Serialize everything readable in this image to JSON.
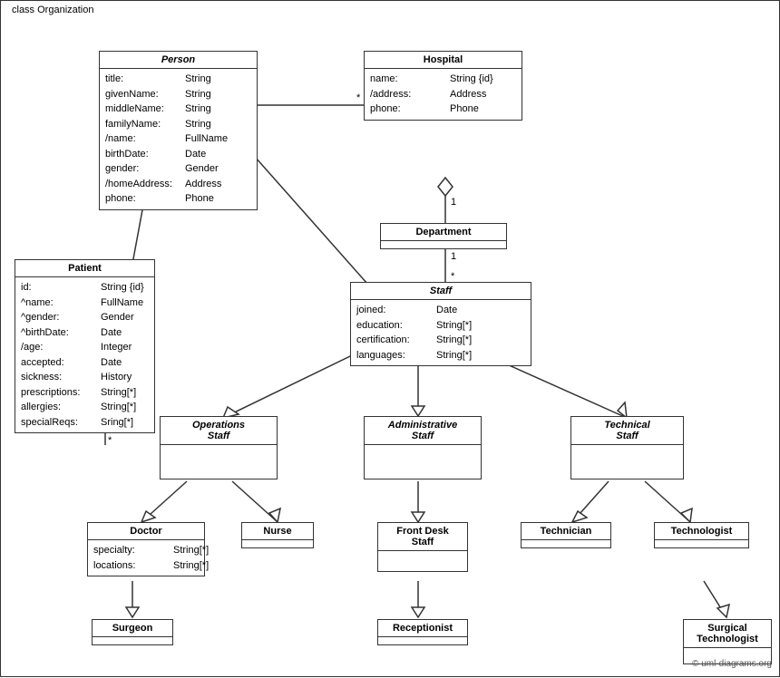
{
  "diagram": {
    "title": "class Organization",
    "classes": {
      "person": {
        "name": "Person",
        "italic": true,
        "attrs": [
          {
            "name": "title:",
            "type": "String"
          },
          {
            "name": "givenName:",
            "type": "String"
          },
          {
            "name": "middleName:",
            "type": "String"
          },
          {
            "name": "familyName:",
            "type": "String"
          },
          {
            "name": "/name:",
            "type": "FullName"
          },
          {
            "name": "birthDate:",
            "type": "Date"
          },
          {
            "name": "gender:",
            "type": "Gender"
          },
          {
            "name": "/homeAddress:",
            "type": "Address"
          },
          {
            "name": "phone:",
            "type": "Phone"
          }
        ]
      },
      "hospital": {
        "name": "Hospital",
        "italic": false,
        "attrs": [
          {
            "name": "name:",
            "type": "String {id}"
          },
          {
            "name": "/address:",
            "type": "Address"
          },
          {
            "name": "phone:",
            "type": "Phone"
          }
        ]
      },
      "department": {
        "name": "Department",
        "italic": false,
        "attrs": []
      },
      "staff": {
        "name": "Staff",
        "italic": true,
        "attrs": [
          {
            "name": "joined:",
            "type": "Date"
          },
          {
            "name": "education:",
            "type": "String[*]"
          },
          {
            "name": "certification:",
            "type": "String[*]"
          },
          {
            "name": "languages:",
            "type": "String[*]"
          }
        ]
      },
      "patient": {
        "name": "Patient",
        "italic": false,
        "attrs": [
          {
            "name": "id:",
            "type": "String {id}"
          },
          {
            "name": "^name:",
            "type": "FullName"
          },
          {
            "name": "^gender:",
            "type": "Gender"
          },
          {
            "name": "^birthDate:",
            "type": "Date"
          },
          {
            "name": "/age:",
            "type": "Integer"
          },
          {
            "name": "accepted:",
            "type": "Date"
          },
          {
            "name": "sickness:",
            "type": "History"
          },
          {
            "name": "prescriptions:",
            "type": "String[*]"
          },
          {
            "name": "allergies:",
            "type": "String[*]"
          },
          {
            "name": "specialReqs:",
            "type": "Sring[*]"
          }
        ]
      },
      "operations_staff": {
        "name": "Operations\nStaff",
        "italic": true,
        "attrs": []
      },
      "administrative_staff": {
        "name": "Administrative\nStaff",
        "italic": true,
        "attrs": []
      },
      "technical_staff": {
        "name": "Technical\nStaff",
        "italic": true,
        "attrs": []
      },
      "doctor": {
        "name": "Doctor",
        "italic": false,
        "attrs": [
          {
            "name": "specialty:",
            "type": "String[*]"
          },
          {
            "name": "locations:",
            "type": "String[*]"
          }
        ]
      },
      "nurse": {
        "name": "Nurse",
        "italic": false,
        "attrs": []
      },
      "front_desk_staff": {
        "name": "Front Desk\nStaff",
        "italic": false,
        "attrs": []
      },
      "technician": {
        "name": "Technician",
        "italic": false,
        "attrs": []
      },
      "technologist": {
        "name": "Technologist",
        "italic": false,
        "attrs": []
      },
      "surgeon": {
        "name": "Surgeon",
        "italic": false,
        "attrs": []
      },
      "receptionist": {
        "name": "Receptionist",
        "italic": false,
        "attrs": []
      },
      "surgical_technologist": {
        "name": "Surgical\nTechnologist",
        "italic": false,
        "attrs": []
      }
    },
    "multiplicity": {
      "star": "*",
      "one": "1"
    },
    "copyright": "© uml-diagrams.org"
  }
}
